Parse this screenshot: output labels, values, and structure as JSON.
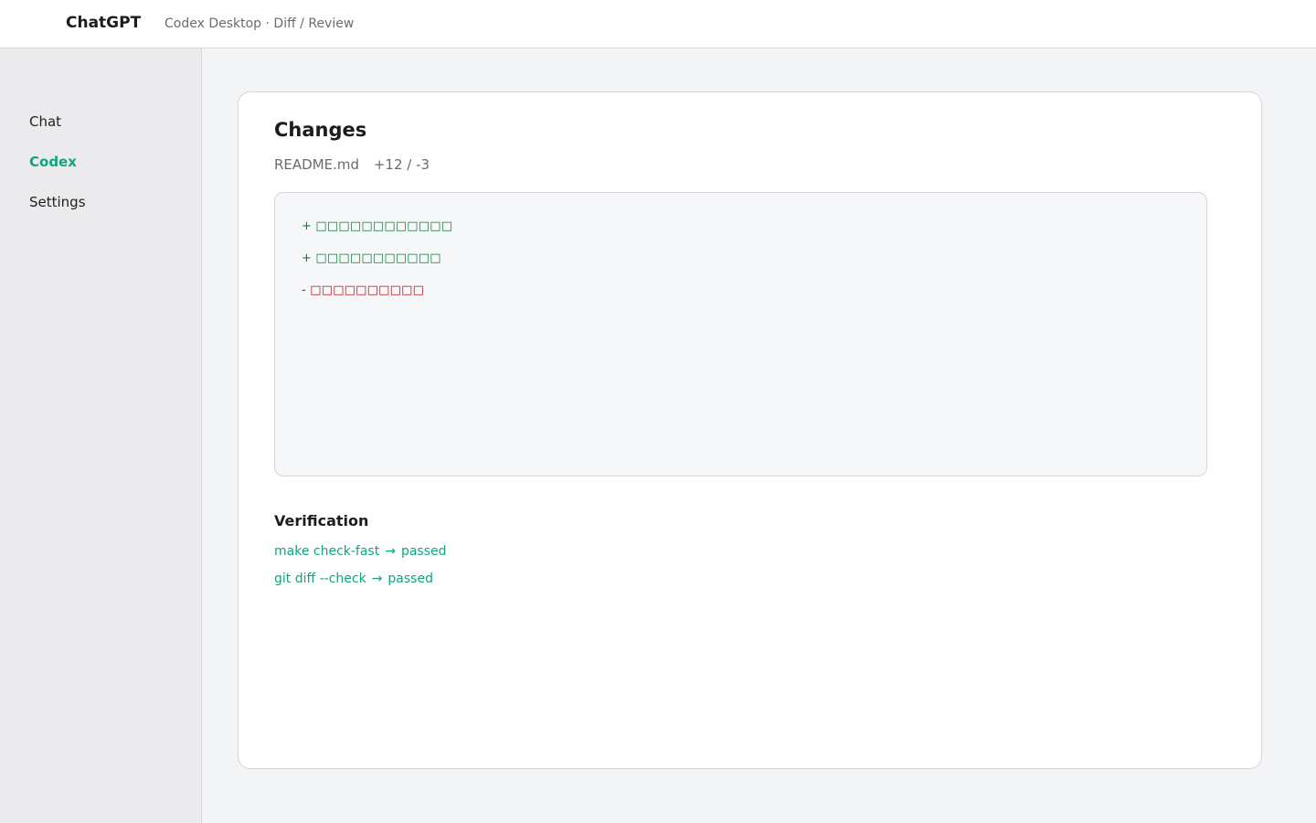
{
  "header": {
    "brand": "ChatGPT",
    "subtitle": "Codex Desktop · Diff / Review"
  },
  "sidebar": {
    "items": [
      {
        "label": "Chat",
        "active": false
      },
      {
        "label": "Codex",
        "active": true
      },
      {
        "label": "Settings",
        "active": false
      }
    ]
  },
  "main": {
    "title": "Changes",
    "file": {
      "name": "README.md",
      "stats": "+12 / -3"
    },
    "diff": {
      "lines": [
        {
          "type": "add",
          "text": "+ □□□□□□□□□□□□"
        },
        {
          "type": "add",
          "text": "+ □□□□□□□□□□□"
        },
        {
          "type": "del",
          "text": "- □□□□□□□□□□"
        }
      ]
    },
    "verification": {
      "title": "Verification",
      "checks": [
        {
          "command": "make check-fast",
          "arrow": "→",
          "result": "passed"
        },
        {
          "command": "git diff --check",
          "arrow": "→",
          "result": "passed"
        }
      ]
    }
  },
  "colors": {
    "accent": "#10a37f",
    "added": "#127a3a",
    "removed": "#b3161d"
  }
}
